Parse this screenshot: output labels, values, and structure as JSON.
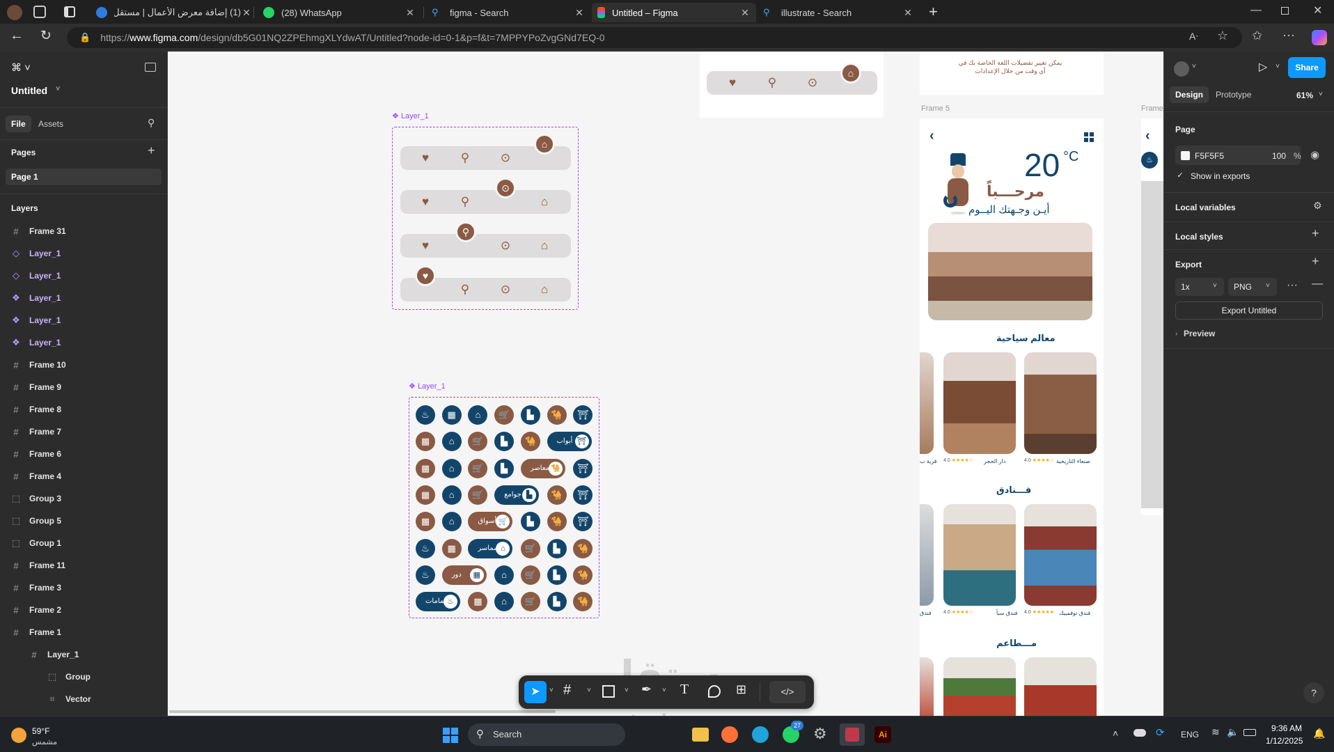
{
  "browser": {
    "tabs": [
      {
        "title": "(1) إضافة معرض الأعمال | مستقل",
        "active": false
      },
      {
        "title": "(28) WhatsApp",
        "active": false
      },
      {
        "title": "figma - Search",
        "active": false
      },
      {
        "title": "Untitled – Figma",
        "active": true
      },
      {
        "title": "illustrate - Search",
        "active": false
      }
    ],
    "url_prefix": "https://",
    "url_domain": "www.figma.com",
    "url_path": "/design/db5G01NQ2ZPEhmgXLYdwAT/Untitled?node-id=0-1&p=f&t=7MPPYPoZvgGNd7EQ-0"
  },
  "figma": {
    "file_name": "Untitled",
    "left_tabs": [
      "File",
      "Assets"
    ],
    "pages_label": "Pages",
    "pages": [
      "Page 1"
    ],
    "layers_label": "Layers",
    "layers": [
      {
        "name": "Frame 31",
        "type": "frame",
        "depth": 0
      },
      {
        "name": "Layer_1",
        "type": "component-outline",
        "depth": 0
      },
      {
        "name": "Layer_1",
        "type": "component-outline",
        "depth": 0
      },
      {
        "name": "Layer_1",
        "type": "component",
        "depth": 0
      },
      {
        "name": "Layer_1",
        "type": "component",
        "depth": 0
      },
      {
        "name": "Layer_1",
        "type": "component",
        "depth": 0
      },
      {
        "name": "Frame 10",
        "type": "frame",
        "depth": 0
      },
      {
        "name": "Frame 9",
        "type": "frame",
        "depth": 0
      },
      {
        "name": "Frame 8",
        "type": "frame",
        "depth": 0
      },
      {
        "name": "Frame 7",
        "type": "frame",
        "depth": 0
      },
      {
        "name": "Frame 6",
        "type": "frame",
        "depth": 0
      },
      {
        "name": "Frame 4",
        "type": "frame",
        "depth": 0
      },
      {
        "name": "Group 3",
        "type": "group",
        "depth": 0
      },
      {
        "name": "Group 5",
        "type": "group",
        "depth": 0
      },
      {
        "name": "Group 1",
        "type": "group",
        "depth": 0
      },
      {
        "name": "Frame 11",
        "type": "frame",
        "depth": 0
      },
      {
        "name": "Frame 3",
        "type": "frame",
        "depth": 0
      },
      {
        "name": "Frame 2",
        "type": "frame",
        "depth": 0
      },
      {
        "name": "Frame 1",
        "type": "frame",
        "depth": 0
      },
      {
        "name": "Layer_1",
        "type": "frame",
        "depth": 1
      },
      {
        "name": "Group",
        "type": "group",
        "depth": 2
      },
      {
        "name": "Vector",
        "type": "vector",
        "depth": 2
      }
    ],
    "canvas": {
      "layer_label_1": "Layer_1",
      "layer_label_2": "Layer_1",
      "frame5_label": "Frame 5",
      "frame_right_label": "Frame",
      "top_note": "يمكن تغيير تفضيلات اللغة الخاصة بك في أي وقت من خلال الإعدادات",
      "pills": [
        "أبواب",
        "معاصر",
        "جوامع",
        "أسواق",
        "سماسر",
        "دور",
        "حمامات"
      ],
      "phone": {
        "temperature": "20",
        "unit": "°C",
        "greeting": "مرحـــباً",
        "question": "أيـن وجـهتك اليــوم",
        "section1": "معالم سياحية",
        "section2": "فـــنادق",
        "section3": "مـــطاعم",
        "places": [
          {
            "name": "صنعاء التاريخية",
            "rating": "4.0"
          },
          {
            "name": "دار الحجر",
            "rating": "4.0"
          },
          {
            "name": "قرية ب",
            "rating": ""
          }
        ],
        "hotels": [
          {
            "name": "فندق توفمبيك",
            "rating": "4.0"
          },
          {
            "name": "فندق سبأ",
            "rating": "4.0"
          },
          {
            "name": "فندق",
            "rating": ""
          }
        ]
      },
      "watermark_1": "مستقل",
      "watermark_2": "mostaql.com"
    },
    "right": {
      "share_label": "Share",
      "tabs": [
        "Design",
        "Prototype"
      ],
      "zoom": "61%",
      "page_label": "Page",
      "page_color": "F5F5F5",
      "page_opacity": "100",
      "percent": "%",
      "show_in_exports": "Show in exports",
      "local_variables": "Local variables",
      "local_styles": "Local styles",
      "export_label": "Export",
      "export_scale": "1x",
      "export_format": "PNG",
      "export_button": "Export Untitled",
      "preview": "Preview",
      "help": "?"
    }
  },
  "taskbar": {
    "weather_temp": "59°F",
    "weather_desc": "مشمس",
    "search": "Search",
    "lang": "ENG",
    "time": "9:36 AM",
    "date": "1/12/2025",
    "whatsapp_badge": "27"
  },
  "colors": {
    "figma_accent": "#0d99ff",
    "brown": "#8a5a44",
    "navy": "#13456b",
    "component": "#9747ff"
  }
}
